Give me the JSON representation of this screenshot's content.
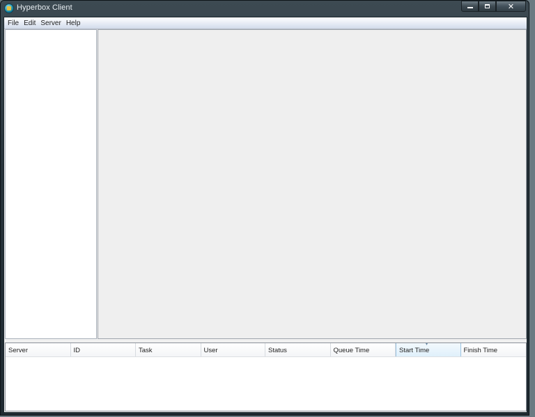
{
  "window": {
    "title": "Hyperbox Client",
    "controls": [
      "minimize",
      "maximize",
      "close"
    ]
  },
  "menubar": {
    "items": [
      {
        "label": "File"
      },
      {
        "label": "Edit"
      },
      {
        "label": "Server"
      },
      {
        "label": "Help"
      }
    ]
  },
  "task_table": {
    "columns": [
      {
        "label": "Server"
      },
      {
        "label": "ID"
      },
      {
        "label": "Task"
      },
      {
        "label": "User"
      },
      {
        "label": "Status"
      },
      {
        "label": "Queue Time"
      },
      {
        "label": "Start Time",
        "sorted": true
      },
      {
        "label": "Finish Time"
      }
    ],
    "rows": []
  },
  "colors": {
    "titlebar": "#27333b",
    "menubar": "#dfe6f2",
    "main_panel": "#efefef",
    "sorted_header": "#dff0fb"
  }
}
